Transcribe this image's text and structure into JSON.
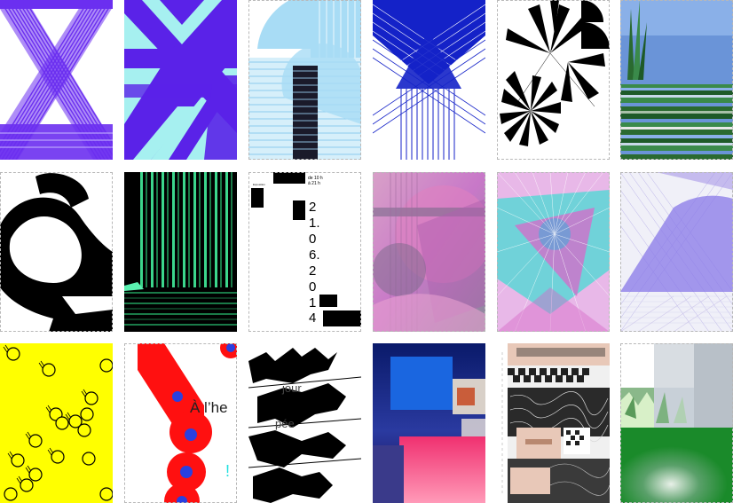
{
  "gallery": {
    "posters": [
      {
        "id": "poster-1",
        "colors": [
          "#6b2ff0",
          "#ffffff"
        ]
      },
      {
        "id": "poster-2",
        "colors": [
          "#5a22e8",
          "#a6f0f0"
        ]
      },
      {
        "id": "poster-3",
        "colors": [
          "#a8dcf5",
          "#1a1a2a"
        ]
      },
      {
        "id": "poster-4",
        "colors": [
          "#1422c8",
          "#ffffff"
        ]
      },
      {
        "id": "poster-5",
        "colors": [
          "#000000",
          "#ffffff"
        ]
      },
      {
        "id": "poster-6",
        "colors": [
          "#3a8a4a",
          "#6a94d8"
        ]
      },
      {
        "id": "poster-7",
        "colors": [
          "#000000",
          "#ffffff"
        ]
      },
      {
        "id": "poster-8",
        "colors": [
          "#0d3a22",
          "#3cd68c"
        ]
      },
      {
        "id": "poster-9",
        "colors": [
          "#000000",
          "#ffffff"
        ]
      },
      {
        "id": "poster-10",
        "colors": [
          "#c878c8",
          "#8a8a9a"
        ]
      },
      {
        "id": "poster-11",
        "colors": [
          "#5ad6d6",
          "#d868c8"
        ]
      },
      {
        "id": "poster-12",
        "colors": [
          "#8878e8",
          "#d8d8f0"
        ]
      },
      {
        "id": "poster-13",
        "colors": [
          "#ffff00",
          "#000000"
        ]
      },
      {
        "id": "poster-14",
        "colors": [
          "#ff1010",
          "#2a40e0"
        ]
      },
      {
        "id": "poster-15",
        "colors": [
          "#000000",
          "#ffffff"
        ]
      },
      {
        "id": "poster-16",
        "colors": [
          "#1a66e0",
          "#f03070"
        ]
      },
      {
        "id": "poster-17",
        "colors": [
          "#e8c8b8",
          "#202020"
        ]
      },
      {
        "id": "poster-18",
        "colors": [
          "#b8c0c8",
          "#1a8a2a"
        ]
      }
    ]
  },
  "poster9": {
    "time_line1": "de 10 h",
    "time_line2": "à 21 h",
    "small_label": "Exposition",
    "date_chars": [
      "2",
      "1.",
      "0",
      "6.",
      "2",
      "0",
      "1",
      "4"
    ]
  },
  "poster14": {
    "headline": "À l’he",
    "exclaim": "!"
  },
  "poster15": {
    "word1": "jour",
    "word2": "pée"
  }
}
